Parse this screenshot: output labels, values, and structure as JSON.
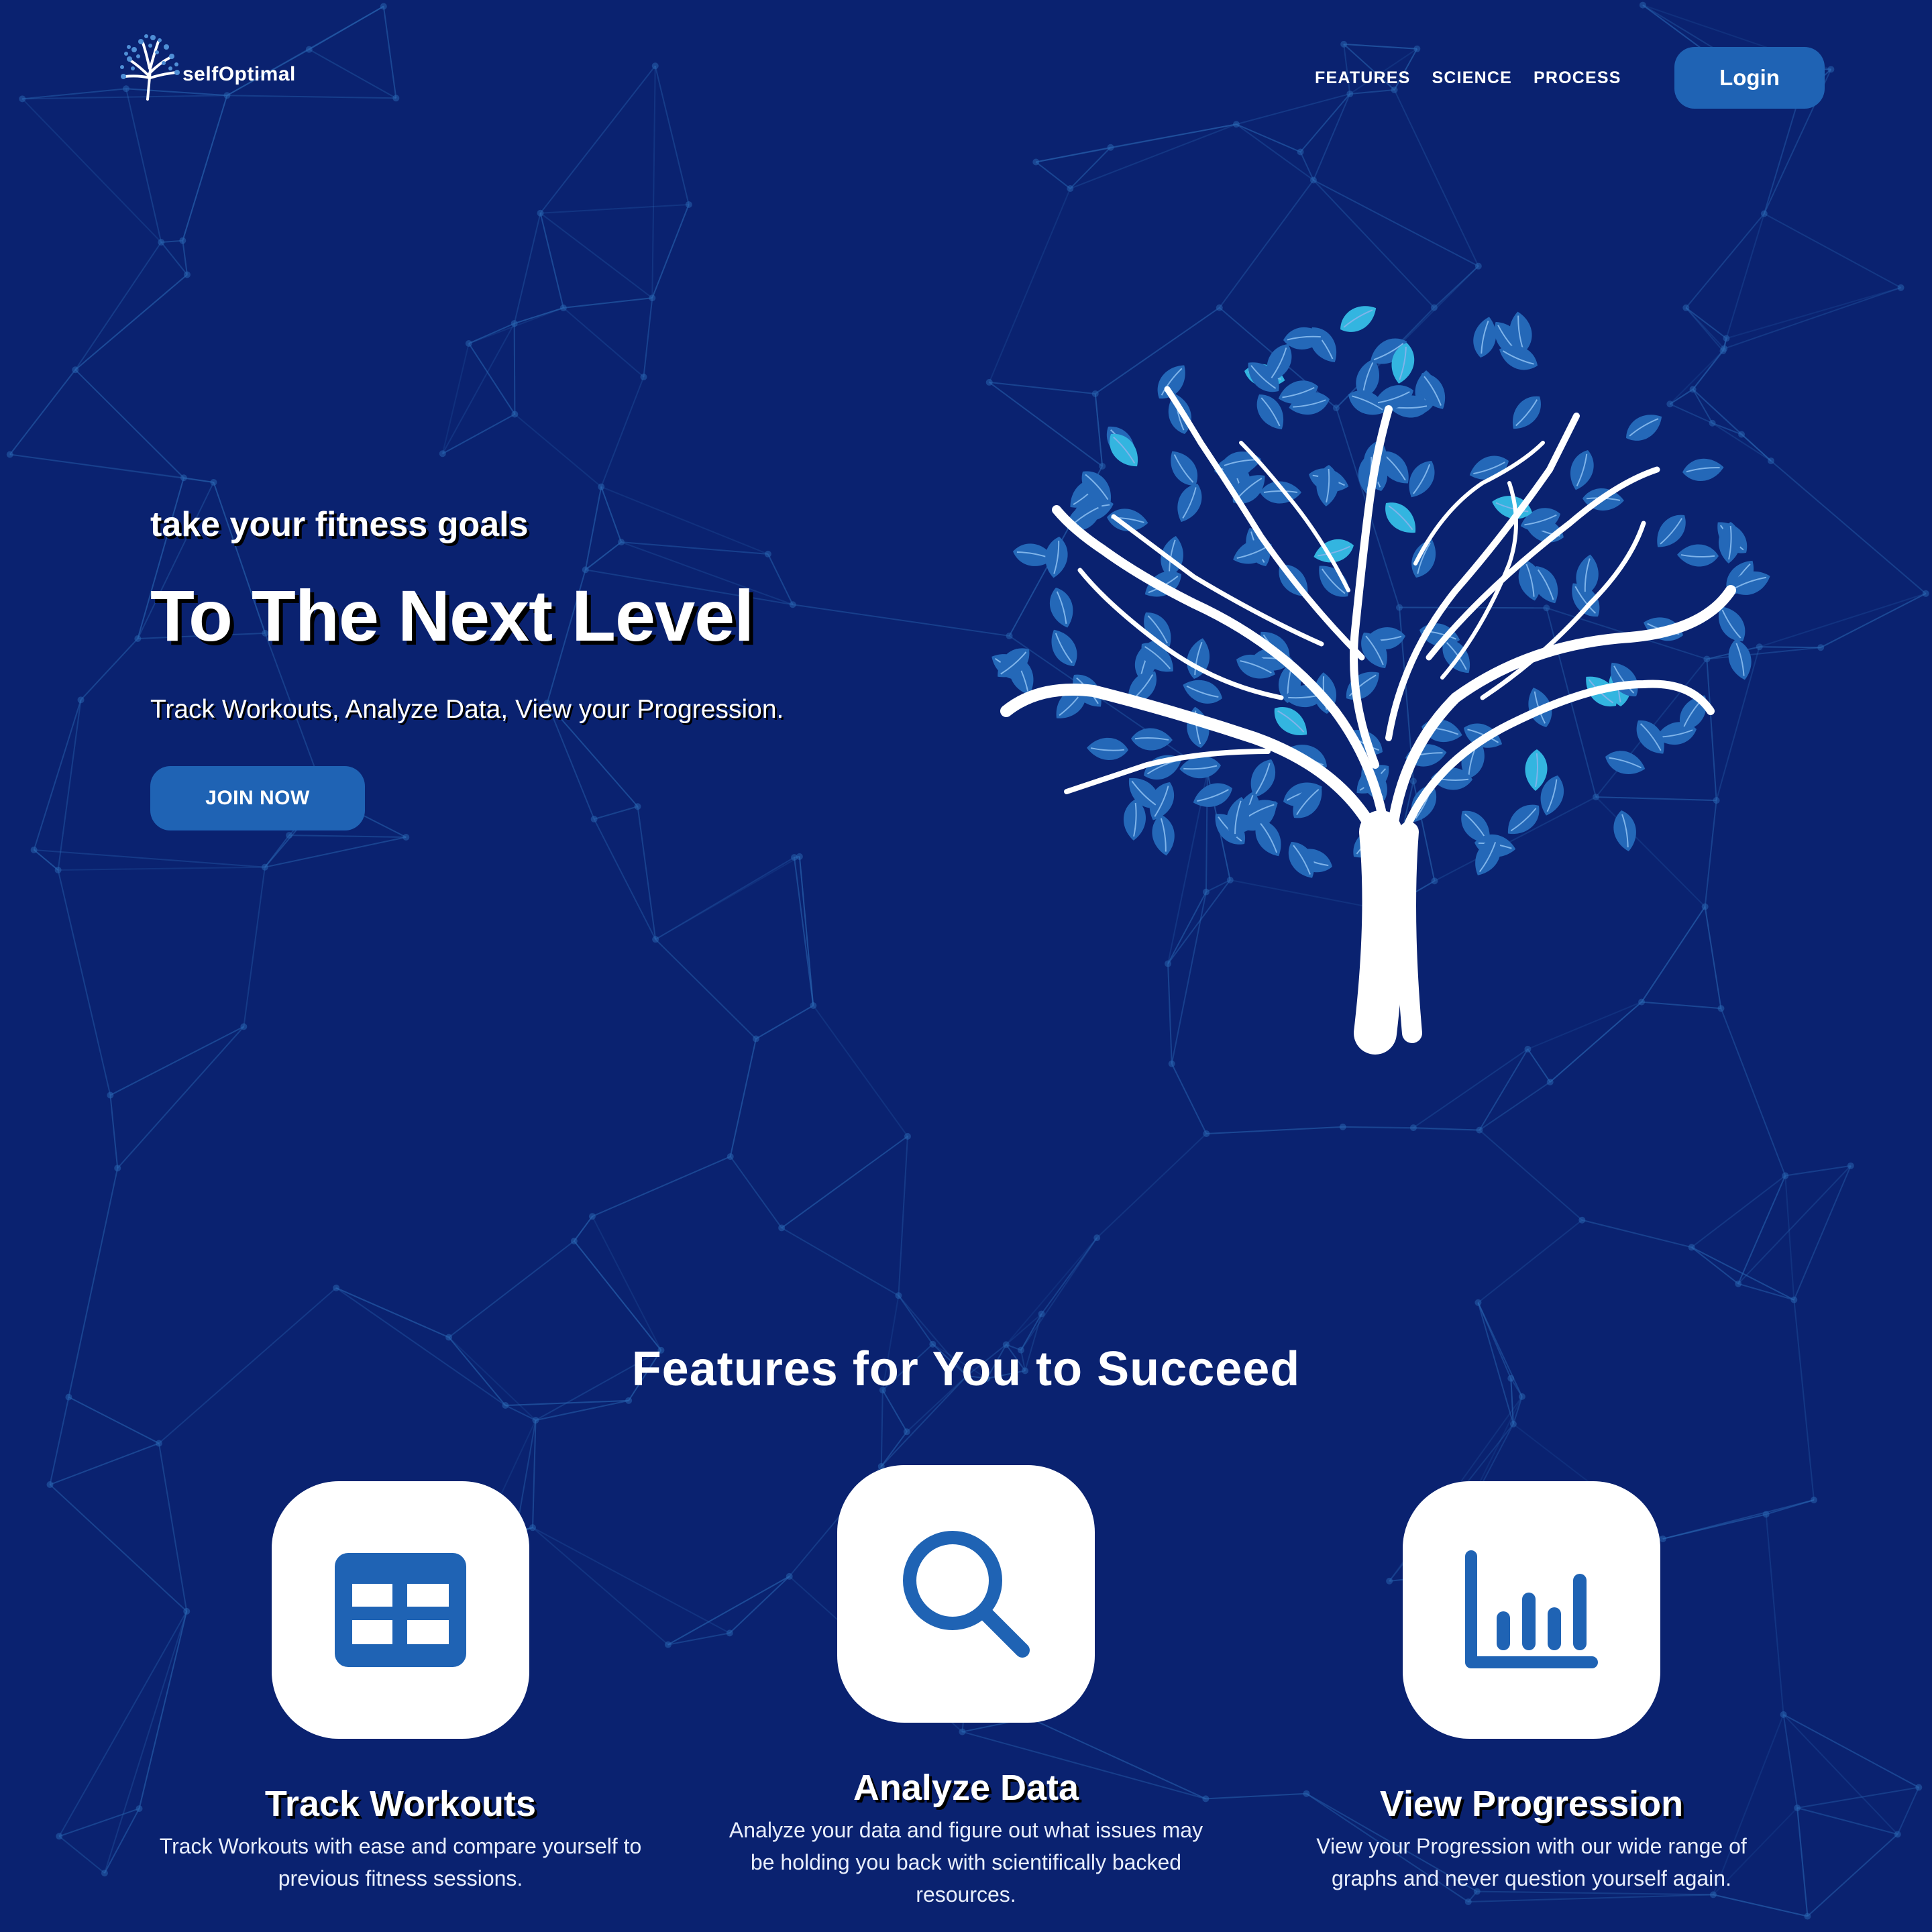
{
  "colors": {
    "background": "#0a2270",
    "accent": "#1f63b4",
    "leaf_blue": "#2468b8",
    "leaf_cyan": "#33b5e0",
    "network_line": "#2a67b3"
  },
  "header": {
    "logo_text": "selfOptimal",
    "logo_icon": "tree-icon",
    "nav": [
      "FEATURES",
      "SCIENCE",
      "PROCESS"
    ],
    "login_label": "Login"
  },
  "hero": {
    "kicker": "take your fitness goals",
    "title": "To The Next Level",
    "subtitle": "Track Workouts, Analyze Data, View your Progression.",
    "cta_label": "JOIN NOW",
    "illustration": "tree-illustration"
  },
  "features": {
    "heading": "Features for You to Succeed",
    "items": [
      {
        "icon": "table-icon",
        "title": "Track Workouts",
        "text": "Track Workouts with ease and compare yourself to previous fitness sessions."
      },
      {
        "icon": "search-icon",
        "title": "Analyze Data",
        "text": "Analyze your data and figure out what issues may be holding you back with scientifically backed resources."
      },
      {
        "icon": "bar-chart-icon",
        "title": "View Progression",
        "text": "View your Progression with our wide range of graphs and never question yourself again."
      }
    ]
  }
}
